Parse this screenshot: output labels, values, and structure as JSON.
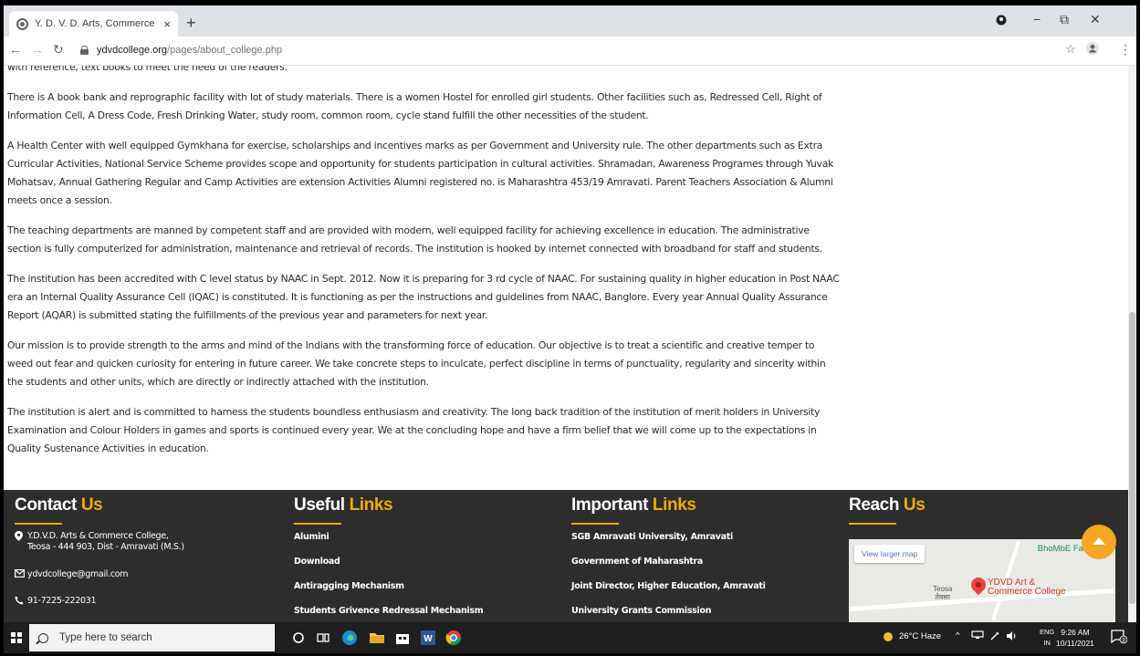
{
  "browser": {
    "tab_title": "Y. D. V. D. Arts, Commerce & Sci",
    "tab_close": "×",
    "new_tab": "+",
    "url_host": "ydvdcollege.org",
    "url_path": "/pages/about_college.php",
    "controls": {
      "minimize": "−",
      "maximize": "⧉",
      "close": "✕"
    },
    "nav": {
      "back": "←",
      "forward": "→",
      "reload": "↻"
    },
    "bookmark": "☆",
    "menu": "⋮"
  },
  "article": {
    "paragraphs": [
      "with reference, text books to meet the need of the readers.",
      "There is A book bank and reprographic facility with lot of study materials. There is a women Hostel for enrolled girl students. Other facilities such as, Redressed Cell, Right of Information Cell, A Dress Code, Fresh Drinking Water, study room, common room, cycle stand fulfill the other necessities of the student.",
      "A Health Center with well equipped Gymkhana for exercise, scholarships and incentives marks as per Government and University rule. The other departments such as Extra Curricular Activities, National Service Scheme provides scope and opportunity for students participation in cultural activities. Shramadan, Awareness Programes through Yuvak Mohatsav, Annual Gathering Regular and Camp Activities are extension Activities Alumni registered no. is Maharashtra 453/19 Amravati. Parent Teachers Association & Alumni meets once a session.",
      "The teaching departments are manned by competent staff and are provided with modern, well equipped facility for achieving excellence in education. The administrative section is fully computerized for administration, maintenance and retrieval of records. The institution is hooked by internet connected with broadband for staff and students.",
      "The institution has been accredited with C level status by NAAC in Sept. 2012. Now it is preparing for 3 rd cycle of NAAC. For sustaining quality in higher education in Post NAAC era an Internal Quality Assurance Cell (IQAC) is constituted. It is functioning as per the instructions and guidelines from NAAC, Banglore. Every year Annual Quality Assurance Report (AQAR) is submitted stating the fulfillments of the previous year and parameters for next year.",
      "Our mission is to provide strength to the arms and mind of the Indians with the transforming force of education. Our objective is to treat a scientific and creative temper to weed out fear and quicken curiosity for entering in future career. We take concrete steps to inculcate, perfect discipline in terms of punctuality, regularity and sincerity within the students and other units, which are directly or indirectly attached with the institution.",
      "The institution is alert and is committed to harness the students boundless enthusiasm and creativity. The long back tradition of the institution of merit holders in University Examination and Colour Holders in games and sports is continued every year. We at the concluding hope and have a firm belief that we will come up to the expectations in Quality Sustenance Activities in education."
    ]
  },
  "footer": {
    "contact": {
      "head_plain": "Contact",
      "head_accent": "Us",
      "address_line1": "Y.D.V.D. Arts & Commerce College,",
      "address_line2": "Teosa - 444 903, Dist - Amravati (M.S.)",
      "email": "ydvdcollege@gmail.com",
      "phone": "91-7225-222031"
    },
    "useful": {
      "head_plain": "Useful",
      "head_accent": "Links",
      "links": [
        "Alumini",
        "Download",
        "Antiragging Mechanism",
        "Students Grivence Redressal Mechanism"
      ]
    },
    "important": {
      "head_plain": "Important",
      "head_accent": "Links",
      "links": [
        "SGB Amravati University, Amravati",
        "Government of Maharashtra",
        "Joint Director, Higher Education, Amravati",
        "University Grants Commission"
      ]
    },
    "reach": {
      "head_plain": "Reach",
      "head_accent": "Us",
      "map": {
        "view_larger": "View larger map",
        "farm_label": "BhoMbE Farm",
        "town_label": "Teosa",
        "town_label_local": "तेवसा",
        "college_label_line1": "YDVD Art &",
        "college_label_line2": "Commerce College"
      }
    }
  },
  "taskbar": {
    "search_placeholder": "Type here to search",
    "weather": "26°C  Haze",
    "lang_top": "ENG",
    "lang_bottom": "IN",
    "time": "9:26 AM",
    "date": "10/11/2021",
    "notif_count": "2"
  },
  "colors": {
    "accent": "#f0ad00",
    "footer_bg": "#2d2d2d",
    "totop": "#f5a623"
  }
}
